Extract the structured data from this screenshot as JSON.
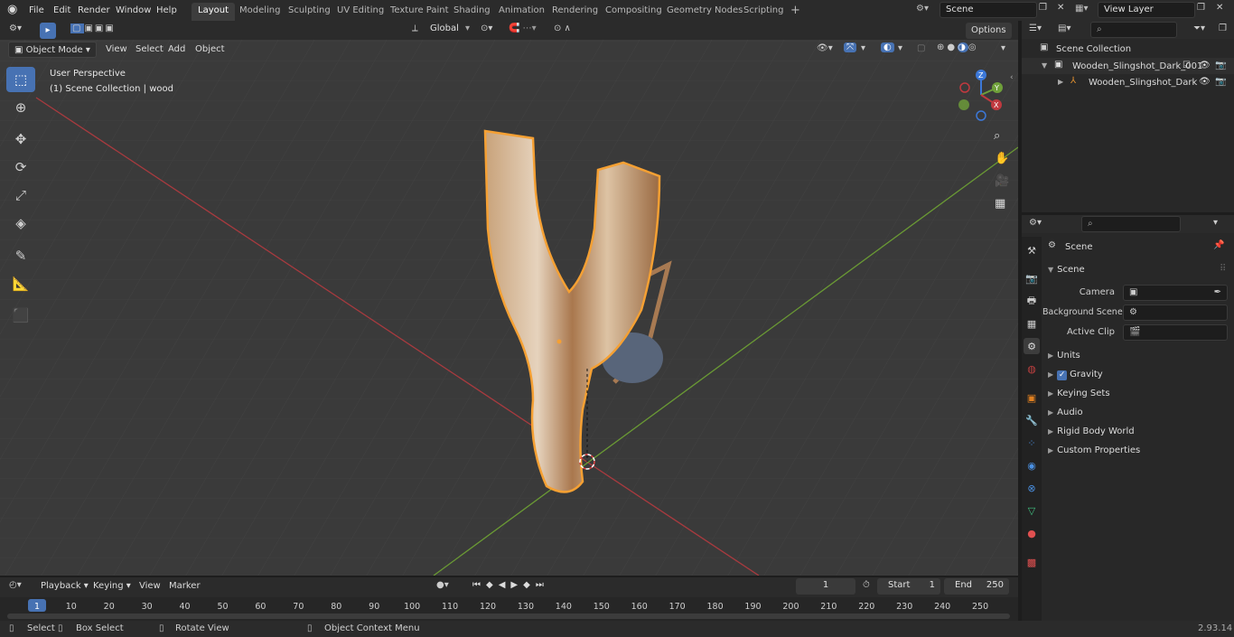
{
  "menu": [
    "File",
    "Edit",
    "Render",
    "Window",
    "Help"
  ],
  "workspace_tabs": [
    "Layout",
    "Modeling",
    "Sculpting",
    "UV Editing",
    "Texture Paint",
    "Shading",
    "Animation",
    "Rendering",
    "Compositing",
    "Geometry Nodes",
    "Scripting"
  ],
  "add_tab": "+",
  "scene_field": "Scene",
  "view_layer_field": "View Layer",
  "tool_header": {
    "transform_orientation": "Global",
    "options": "Options"
  },
  "viewport_header": {
    "mode": "Object Mode",
    "view": "View",
    "select": "Select",
    "add": "Add",
    "object": "Object"
  },
  "viewport": {
    "perspective": "User Perspective",
    "collection_info": "(1) Scene Collection | wood"
  },
  "gizmo": {
    "z": "Z",
    "y": "Y",
    "x": "X"
  },
  "outliner": {
    "root": "Scene Collection",
    "collection": "Wooden_Slingshot_Dark_001",
    "object": "Wooden_Slingshot_Dark"
  },
  "properties": {
    "header": "Scene",
    "panel": "Scene",
    "camera": "Camera",
    "background_scene": "Background Scene",
    "active_clip": "Active Clip",
    "sections": [
      "Units",
      "Gravity",
      "Keying Sets",
      "Audio",
      "Rigid Body World",
      "Custom Properties"
    ]
  },
  "timeline": {
    "playback": "Playback",
    "keying": "Keying",
    "view": "View",
    "marker": "Marker",
    "current_frame": "1",
    "start_label": "Start",
    "start": "1",
    "end_label": "End",
    "end": "250",
    "frames": [
      "1",
      "10",
      "20",
      "30",
      "40",
      "50",
      "60",
      "70",
      "80",
      "90",
      "100",
      "110",
      "120",
      "130",
      "140",
      "150",
      "160",
      "170",
      "180",
      "190",
      "200",
      "210",
      "220",
      "230",
      "240",
      "250"
    ]
  },
  "status": {
    "select": "Select",
    "box_select": "Box Select",
    "rotate": "Rotate View",
    "context": "Object Context Menu",
    "version": "2.93.14"
  },
  "colors": {
    "accent": "#4772b3",
    "selection": "#f5a033",
    "axis_x": "#c0393f",
    "axis_y": "#6fa03a"
  }
}
